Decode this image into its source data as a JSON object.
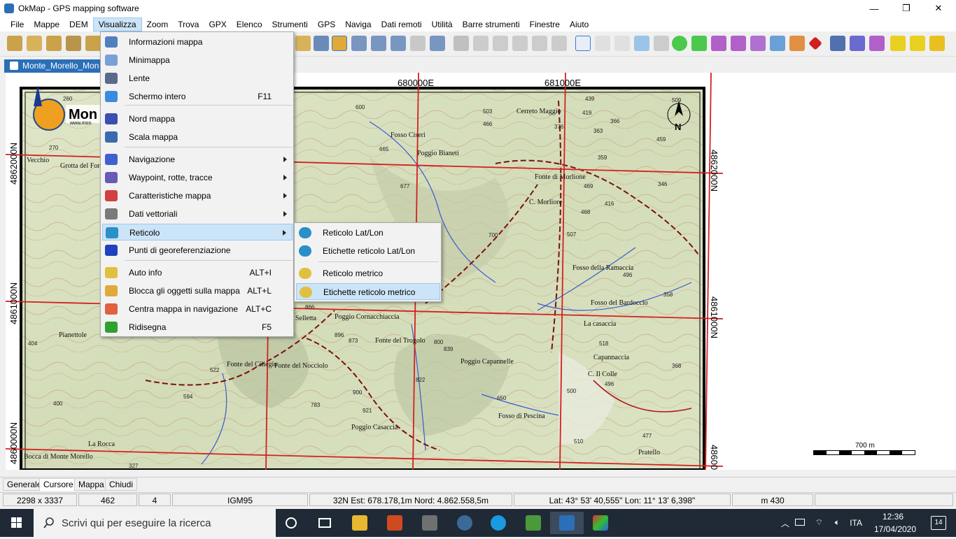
{
  "window": {
    "title": "OkMap - GPS mapping software",
    "controls": [
      "—",
      "❐",
      "✕"
    ]
  },
  "menubar": {
    "items": [
      "File",
      "Mappe",
      "DEM",
      "Visualizza",
      "Zoom",
      "Trova",
      "GPX",
      "Elenco",
      "Strumenti",
      "GPS",
      "Naviga",
      "Dati remoti",
      "Utilità",
      "Barre strumenti",
      "Finestre",
      "Aiuto"
    ],
    "active": "Visualizza"
  },
  "document_tab": {
    "label": "Monte_Morello_Mon"
  },
  "map": {
    "logo_text": "Mon",
    "logo_url": "www.mon",
    "north_label": "N",
    "easting_labels": [
      "680000E",
      "681000E"
    ],
    "northing_labels": [
      "4862000N",
      "4861000N",
      "4860000N"
    ],
    "place_labels": [
      "Poggio Bianeti",
      "Cerreto Maggio",
      "C. Morliore",
      "Fonte di Morlione",
      "Fosso della Ramaccia",
      "Fosso del Bardoccio",
      "La casaccia",
      "Capannaccia",
      "C. Il Colle",
      "Poggio Capannelle",
      "Poggio Cornacchiaccia",
      "Fonte del Trogolo",
      "Fosso di Pescina",
      "Poggio Casaccia",
      "Fonte del Ciliegio",
      "Fonte del Nocciolo",
      "Pianettole",
      "Pratello",
      "Vecchio",
      "Grotta del Fornaccio",
      "La Rocca",
      "Bocca di Monte Morello",
      "Selletta",
      "Fosso Ciseri"
    ],
    "elevation_labels": [
      "260",
      "270",
      "503",
      "466",
      "376",
      "439",
      "419",
      "363",
      "366",
      "509",
      "459",
      "665",
      "359",
      "677",
      "469",
      "346",
      "416",
      "468",
      "507",
      "496",
      "358",
      "518",
      "496",
      "500",
      "368",
      "866",
      "896",
      "873",
      "839",
      "822",
      "650",
      "921",
      "783",
      "594",
      "522",
      "404",
      "510",
      "477",
      "327",
      "600",
      "700",
      "400",
      "900",
      "800"
    ]
  },
  "scalebar": {
    "label": "700 m"
  },
  "visualizza_menu": {
    "items": [
      {
        "label": "Informazioni mappa",
        "shortcut": "",
        "submenu": false,
        "icon": "map-info-icon"
      },
      {
        "label": "Minimappa",
        "shortcut": "",
        "submenu": false,
        "icon": "minimap-icon"
      },
      {
        "label": "Lente",
        "shortcut": "",
        "submenu": false,
        "icon": "magnifier-icon"
      },
      {
        "label": "Schermo intero",
        "shortcut": "F11",
        "submenu": false,
        "icon": "fullscreen-icon"
      },
      {
        "label": "Nord mappa",
        "shortcut": "",
        "submenu": false,
        "icon": "north-arrow-icon"
      },
      {
        "label": "Scala mappa",
        "shortcut": "",
        "submenu": false,
        "icon": "scale-icon"
      },
      {
        "label": "Navigazione",
        "shortcut": "",
        "submenu": true,
        "icon": "navigation-icon"
      },
      {
        "label": "Waypoint, rotte, tracce",
        "shortcut": "",
        "submenu": true,
        "icon": "waypoint-icon"
      },
      {
        "label": "Caratteristiche mappa",
        "shortcut": "",
        "submenu": true,
        "icon": "map-features-icon"
      },
      {
        "label": "Dati vettoriali",
        "shortcut": "",
        "submenu": true,
        "icon": "vector-data-icon"
      },
      {
        "label": "Reticolo",
        "shortcut": "",
        "submenu": true,
        "icon": "grid-globe-icon"
      },
      {
        "label": "Punti di georeferenziazione",
        "shortcut": "",
        "submenu": false,
        "icon": "georef-cross-icon"
      },
      {
        "label": "Auto info",
        "shortcut": "ALT+I",
        "submenu": false,
        "icon": "auto-info-icon"
      },
      {
        "label": "Blocca gli oggetti sulla mappa",
        "shortcut": "ALT+L",
        "submenu": false,
        "icon": "lock-icon"
      },
      {
        "label": "Centra mappa in navigazione",
        "shortcut": "ALT+C",
        "submenu": false,
        "icon": "center-map-icon"
      },
      {
        "label": "Ridisegna",
        "shortcut": "F5",
        "submenu": false,
        "icon": "redraw-icon"
      }
    ],
    "highlighted": "Reticolo"
  },
  "reticolo_submenu": {
    "items": [
      {
        "label": "Reticolo Lat/Lon",
        "icon": "latlon-grid-icon"
      },
      {
        "label": "Etichette reticolo Lat/Lon",
        "icon": "latlon-labels-icon"
      },
      {
        "label": "Reticolo metrico",
        "icon": "metric-grid-icon"
      },
      {
        "label": "Etichette reticolo metrico",
        "icon": "metric-labels-icon"
      }
    ],
    "highlighted": "Etichette reticolo metrico"
  },
  "bottom_tabs": {
    "items": [
      "Generale",
      "Cursore",
      "Mappa",
      "Chiudi"
    ],
    "active": "Cursore"
  },
  "statusbar": {
    "cells": [
      "2298 x 3337",
      "462",
      "4",
      "IGM95",
      "32N  Est: 678.178,1m  Nord: 4.862.558,5m",
      "Lat: 43° 53' 40,555\"  Lon: 11° 13' 6,398\"",
      "m 430"
    ]
  },
  "taskbar": {
    "search_placeholder": "Scrivi qui per eseguire la ricerca",
    "language": "ITA",
    "time": "12:36",
    "date": "17/04/2020",
    "notification_count": "14"
  },
  "colors": {
    "accent": "#2a6fb8",
    "menu_highlight": "#cce4f7",
    "grid_red": "#d42020",
    "map_green": "#dde6c8",
    "taskbar": "#1f2a36"
  }
}
